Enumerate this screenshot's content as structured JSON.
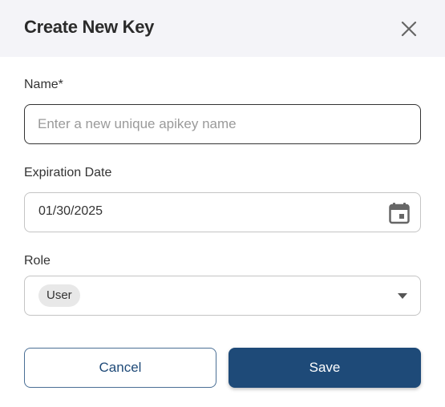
{
  "dialog": {
    "title": "Create New Key",
    "close_icon": "close-icon"
  },
  "form": {
    "name": {
      "label": "Name*",
      "value": "",
      "placeholder": "Enter a new unique apikey name"
    },
    "expiration": {
      "label": "Expiration Date",
      "value": "01/30/2025",
      "icon": "calendar-icon"
    },
    "role": {
      "label": "Role",
      "selected": [
        "User"
      ],
      "icon": "chevron-down-icon"
    }
  },
  "actions": {
    "cancel_label": "Cancel",
    "save_label": "Save"
  },
  "colors": {
    "header_bg": "#f4f4f8",
    "primary": "#1e4a78",
    "chip_bg": "#e8e8e8"
  }
}
